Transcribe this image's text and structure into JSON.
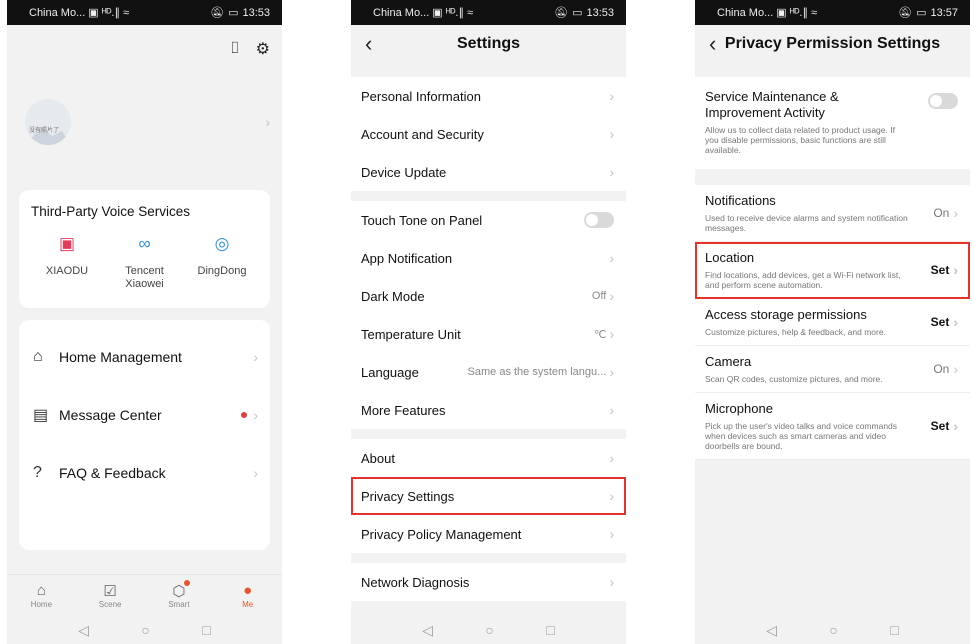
{
  "status_left": "China Mo... ▣ ᴴᴰ.∥ ≈",
  "panel1": {
    "time": "13:53",
    "voice": {
      "heading": "Third-Party Voice Services",
      "items": [
        {
          "icon": "xiaodu-icon",
          "glyph": "▣",
          "color": "#e23b5a",
          "name": "XIAODU"
        },
        {
          "icon": "tencent-xiaowei-icon",
          "glyph": "∞",
          "color": "#2e8fe6",
          "name": "Tencent\nXiaowei"
        },
        {
          "icon": "dingdong-icon",
          "glyph": "◎",
          "color": "#2e8fe6",
          "name": "DingDong"
        }
      ]
    },
    "avatar_text": "没有照片了",
    "menu": [
      {
        "label": "Home Management",
        "icon": "home-icon",
        "glyph": "⌂"
      },
      {
        "label": "Message Center",
        "icon": "message-icon",
        "glyph": "▤"
      },
      {
        "label": "FAQ & Feedback",
        "icon": "question-icon",
        "glyph": "?"
      }
    ],
    "tabs": [
      {
        "label": "Home",
        "glyph": "⌂"
      },
      {
        "label": "Scene",
        "glyph": "☑"
      },
      {
        "label": "Smart",
        "glyph": "⬡"
      },
      {
        "label": "Me",
        "glyph": "●"
      }
    ]
  },
  "panel2": {
    "time": "13:53",
    "title": "Settings",
    "rows": {
      "personal": "Personal Information",
      "account": "Account and Security",
      "device_update": "Device Update",
      "touch_tone": "Touch Tone on Panel",
      "app_notification": "App Notification",
      "dark_mode": "Dark Mode",
      "dark_mode_value": "Off",
      "temp_unit": "Temperature Unit",
      "temp_unit_value": "℃",
      "language": "Language",
      "language_value": "Same as the system langu...",
      "more_features": "More Features",
      "about": "About",
      "privacy_settings": "Privacy Settings",
      "privacy_policy": "Privacy Policy Management",
      "network": "Network Diagnosis"
    }
  },
  "panel3": {
    "time": "13:57",
    "title": "Privacy Permission Settings",
    "service": {
      "title": "Service Maintenance & Improvement Activity",
      "desc": "Allow us to collect data related to product usage. If you disable permissions, basic functions are still available."
    },
    "permissions": [
      {
        "title": "Notifications",
        "desc": "Used to receive device alarms and system notification messages.",
        "value": "On",
        "set": false
      },
      {
        "title": "Location",
        "desc": "Find locations, add devices, get a Wi-Fi network list, and perform scene automation.",
        "value": "Set",
        "set": true
      },
      {
        "title": "Access storage permissions",
        "desc": "Customize pictures, help & feedback, and more.",
        "value": "Set",
        "set": true
      },
      {
        "title": "Camera",
        "desc": "Scan QR codes, customize pictures, and more.",
        "value": "On",
        "set": false
      },
      {
        "title": "Microphone",
        "desc": "Pick up the user's video talks and voice commands when devices such as smart cameras and video doorbells are bound.",
        "value": "Set",
        "set": true
      }
    ]
  },
  "colors": {
    "accent": "#e8552a",
    "highlight": "#e5332a",
    "toggle_off": "#d9d9d9"
  }
}
